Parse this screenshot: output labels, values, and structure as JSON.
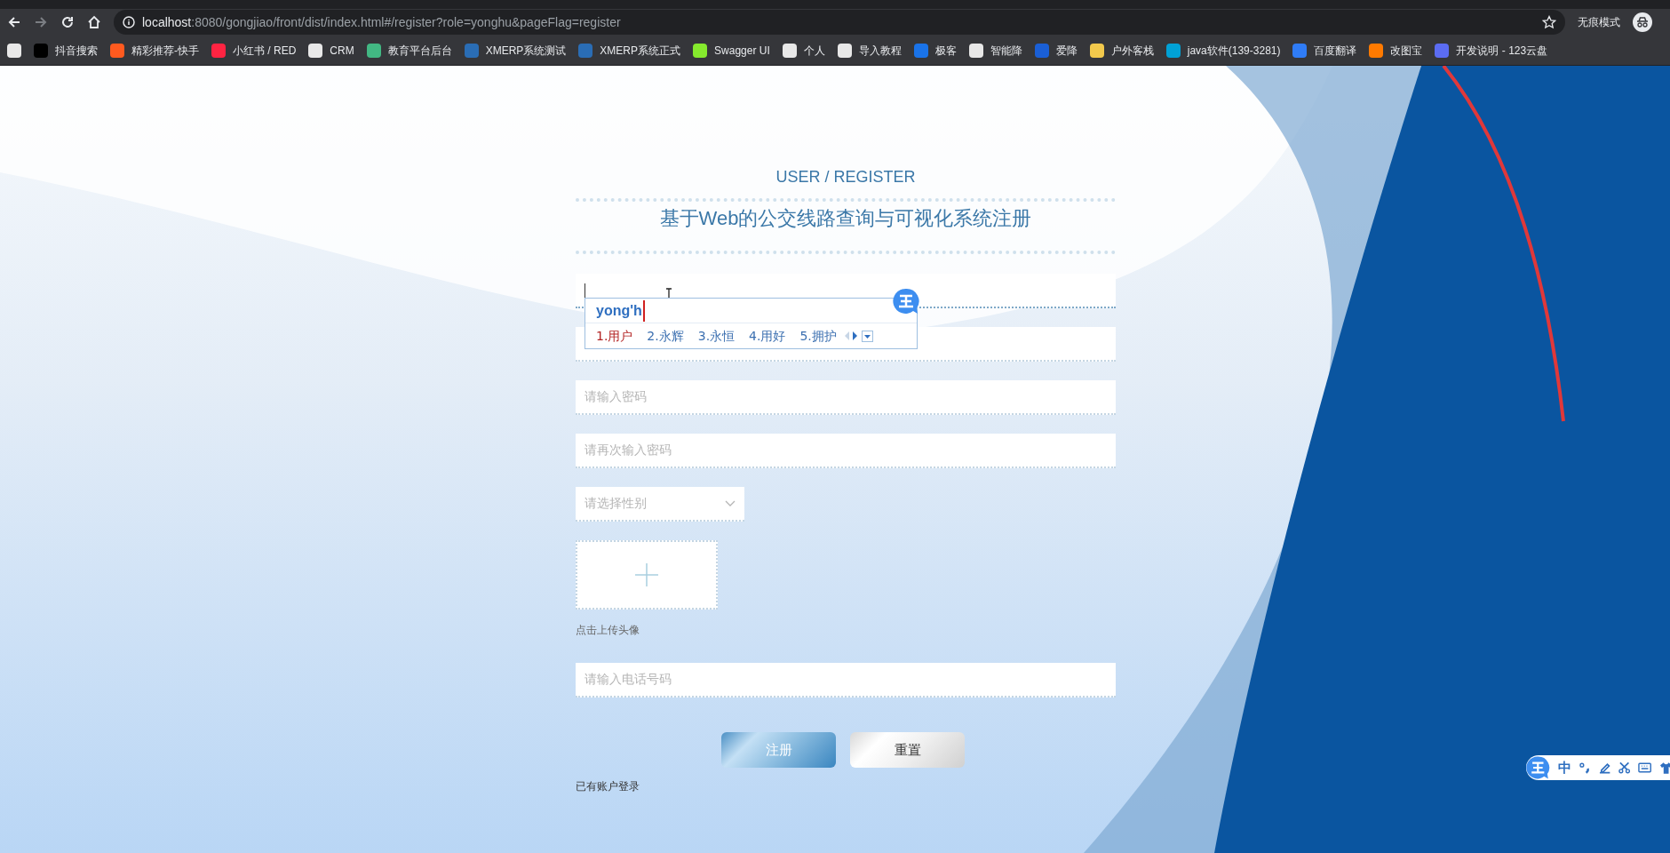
{
  "browser": {
    "url_host": "localhost",
    "url_rest": ":8080/gongjiao/front/dist/index.html#/register?role=yonghu&pageFlag=register",
    "profile_label": "无痕模式",
    "bookmarks": [
      {
        "color": "#e8e8e8"
      },
      {
        "label": "抖音搜索",
        "color": "#000000"
      },
      {
        "label": "精彩推荐-快手",
        "color": "#ff5a1f"
      },
      {
        "label": "小红书 / RED",
        "color": "#ff2442"
      },
      {
        "label": "CRM",
        "color": "#e8e8e8"
      },
      {
        "label": "教育平台后台",
        "color": "#42b883"
      },
      {
        "label": "XMERP系统测试",
        "color": "#2a6db5"
      },
      {
        "label": "XMERP系统正式",
        "color": "#2a6db5"
      },
      {
        "label": "Swagger UI",
        "color": "#85ea2d"
      },
      {
        "label": "个人",
        "color": "#e8e8e8"
      },
      {
        "label": "导入教程",
        "color": "#e8e8e8"
      },
      {
        "label": "极客",
        "color": "#1a73e8"
      },
      {
        "label": "智能降",
        "color": "#e8e8e8"
      },
      {
        "label": "爱降",
        "color": "#1a5fd6"
      },
      {
        "label": "户外客栈",
        "color": "#f2c94c"
      },
      {
        "label": "java软件(139-3281)",
        "color": "#00a1d6"
      },
      {
        "label": "百度翻译",
        "color": "#2f7cf6"
      },
      {
        "label": "改图宝",
        "color": "#ff7a00"
      },
      {
        "label": "开发说明 - 123云盘",
        "color": "#5b6cf2"
      }
    ]
  },
  "form": {
    "heading": "USER / REGISTER",
    "title": "基于Web的公交线路查询与可视化系统注册",
    "fields": [
      {
        "kind": "input",
        "focused": true
      },
      {
        "kind": "input",
        "focused": false
      },
      {
        "kind": "input",
        "focused": false,
        "placeholder": "请输入密码"
      },
      {
        "kind": "input",
        "focused": false,
        "placeholder": "请再次输入密码"
      },
      {
        "kind": "select",
        "focused": false,
        "placeholder": "请选择性别"
      },
      {
        "kind": "upload",
        "focused": false,
        "caption": "点击上传头像"
      },
      {
        "kind": "input",
        "focused": false,
        "placeholder": "请输入电话号码"
      }
    ],
    "buttons": [
      {
        "kind": "primary",
        "label": "注册"
      },
      {
        "kind": "secondary",
        "label": "重置"
      }
    ],
    "login_link": "已有账户登录"
  },
  "ime": {
    "composition": "yong'h",
    "candidates": [
      {
        "label": "1.用户",
        "selected": true
      },
      {
        "label": "2.永辉",
        "selected": false
      },
      {
        "label": "3.永恒",
        "selected": false
      },
      {
        "label": "4.用好",
        "selected": false
      },
      {
        "label": "5.拥护",
        "selected": false
      }
    ],
    "toolbar_mode": "中"
  }
}
